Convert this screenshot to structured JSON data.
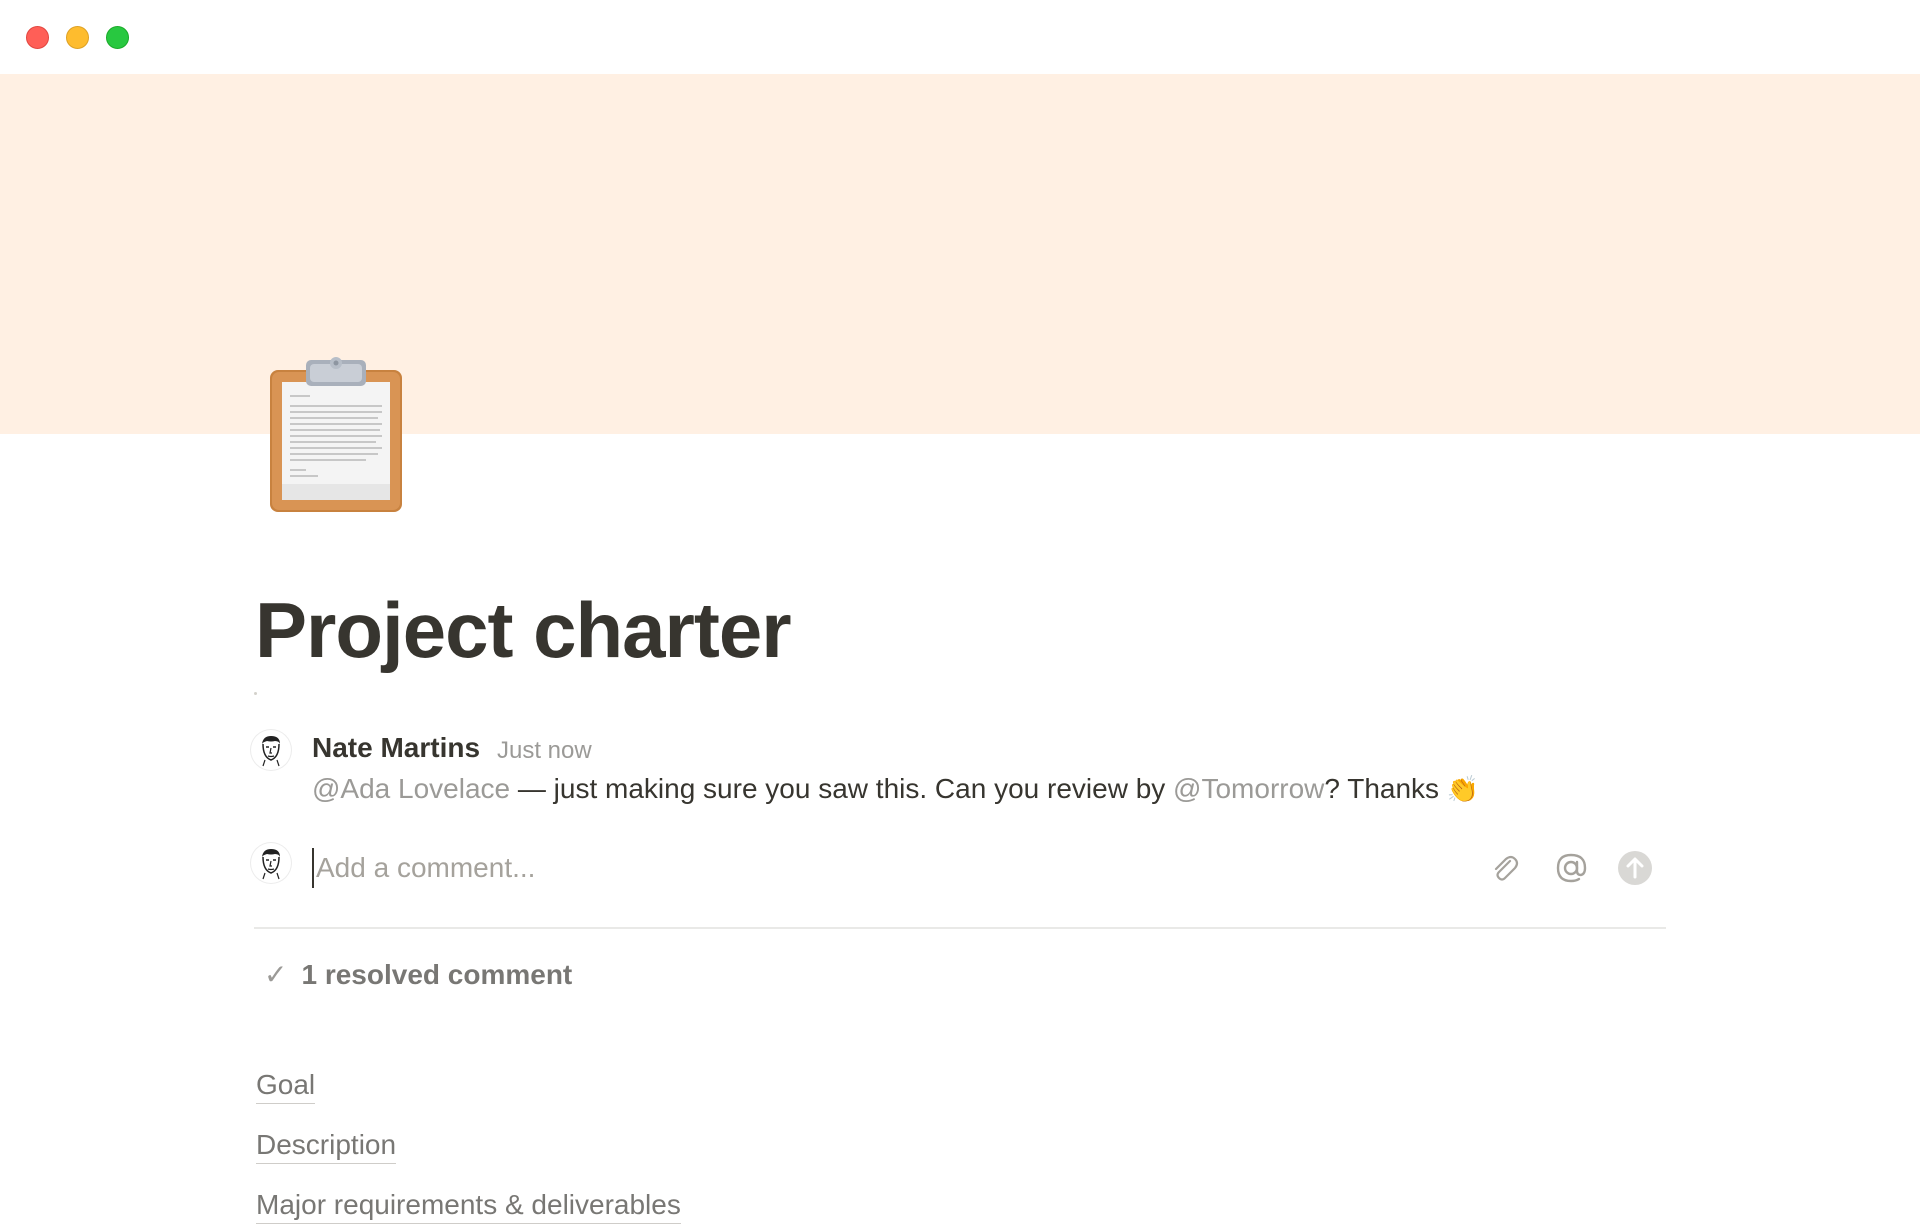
{
  "window": {
    "controls": [
      "close",
      "minimize",
      "zoom"
    ]
  },
  "cover": {
    "color": "#fff0e3"
  },
  "page": {
    "icon": "clipboard-icon",
    "title": "Project charter"
  },
  "comment": {
    "author": "Nate Martins",
    "time": "Just now",
    "mention_user": "@Ada Lovelace",
    "text_middle": " — just making sure you saw this. Can you review by ",
    "mention_date": "@Tomorrow",
    "text_end": "? Thanks ",
    "emoji": "👏"
  },
  "composer": {
    "placeholder": "Add a comment...",
    "icons": [
      "paperclip-icon",
      "at-sign-icon",
      "send-arrow-icon"
    ]
  },
  "resolved": {
    "label": "1 resolved comment"
  },
  "toc": {
    "items": [
      "Goal",
      "Description",
      "Major requirements & deliverables"
    ]
  }
}
